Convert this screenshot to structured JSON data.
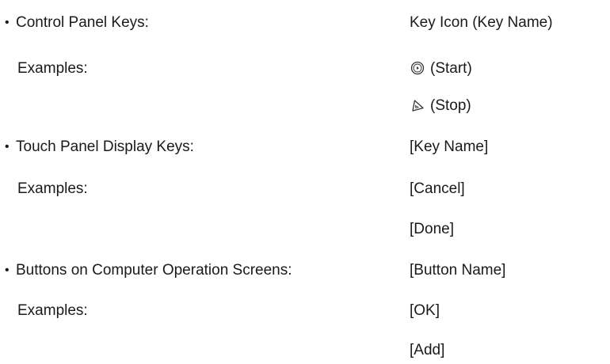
{
  "bullet": "•",
  "sections": [
    {
      "heading": "Control Panel Keys:",
      "format": "Key Icon (Key Name)",
      "examples_label": "Examples:",
      "examples": [
        {
          "icon": "start-key-icon",
          "text": "(Start)"
        },
        {
          "icon": "stop-key-icon",
          "text": "(Stop)"
        }
      ]
    },
    {
      "heading": "Touch Panel Display Keys:",
      "format": "[Key Name]",
      "examples_label": "Examples:",
      "examples": [
        {
          "text": "[Cancel]"
        },
        {
          "text": "[Done]"
        }
      ]
    },
    {
      "heading": "Buttons on Computer Operation Screens:",
      "format": "[Button Name]",
      "examples_label": "Examples:",
      "examples": [
        {
          "text": "[OK]"
        },
        {
          "text": "[Add]"
        }
      ]
    }
  ]
}
